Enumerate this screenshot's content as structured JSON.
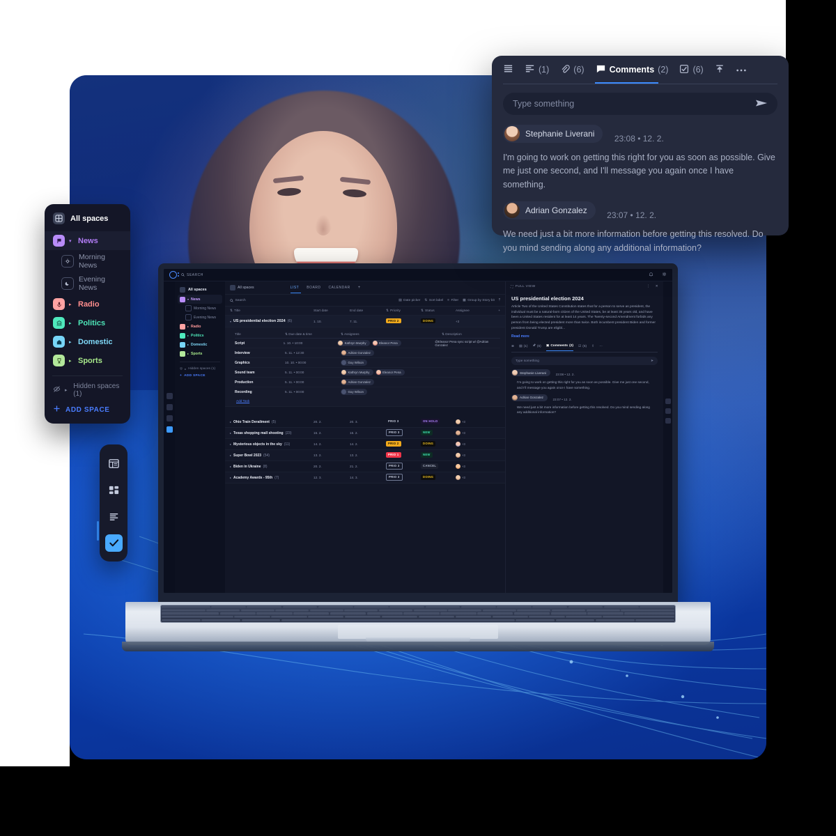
{
  "spaces_panel": {
    "header": "All spaces",
    "items": [
      {
        "label": "News",
        "icon": "flag-icon",
        "color": "#b17cf5",
        "bg": "#b88cf8",
        "expanded": true,
        "children": [
          {
            "label": "Morning News",
            "icon": "sun-icon"
          },
          {
            "label": "Evening News",
            "icon": "moon-icon"
          }
        ]
      },
      {
        "label": "Radio",
        "icon": "microphone-icon",
        "color": "#ff8d8d",
        "bg": "#ffa3a3"
      },
      {
        "label": "Politics",
        "icon": "bank-icon",
        "color": "#4ee6b8",
        "bg": "#4fe9bd"
      },
      {
        "label": "Domestic",
        "icon": "home-icon",
        "color": "#7fd8f7",
        "bg": "#77d5f7"
      },
      {
        "label": "Sports",
        "icon": "trophy-icon",
        "color": "#a7e88a",
        "bg": "#b3e89b"
      }
    ],
    "hidden_spaces": "Hidden spaces (1)",
    "add_space": "ADD SPACE"
  },
  "view_toolbar": {
    "buttons": [
      {
        "icon": "table-view-icon",
        "selected": false
      },
      {
        "icon": "board-view-icon",
        "selected": false
      },
      {
        "icon": "list-view-icon",
        "selected": false
      },
      {
        "icon": "checklist-view-icon",
        "selected": true
      }
    ]
  },
  "comments_card": {
    "tabs": [
      {
        "icon": "menu-icon",
        "label": "",
        "count": ""
      },
      {
        "icon": "description-icon",
        "label": "",
        "count": "(1)"
      },
      {
        "icon": "attachment-icon",
        "label": "",
        "count": "(6)"
      },
      {
        "icon": "comment-icon",
        "label": "Comments",
        "count": "(2)",
        "active": true
      },
      {
        "icon": "checkbox-icon",
        "label": "",
        "count": "(6)"
      },
      {
        "icon": "upload-icon",
        "label": "",
        "count": ""
      },
      {
        "icon": "more-icon",
        "label": "",
        "count": ""
      }
    ],
    "input_placeholder": "Type something",
    "send_icon": "send-icon",
    "messages": [
      {
        "author": "Stephanie Liverani",
        "time": "23:08 • 12. 2.",
        "avatar": "female",
        "body": "I'm going to work on getting this right for you as soon as possible. Give me just one second, and I'll message you again once I have something."
      },
      {
        "author": "Adrian Gonzalez",
        "time": "23:07 • 12. 2.",
        "avatar": "male",
        "body": "We need just a bit more information before getting this resolved. Do you mind sending along any additional information?"
      }
    ]
  },
  "app": {
    "topbar": {
      "search_placeholder": "SEARCH",
      "bell_icon": "bell-icon",
      "gear_icon": "gear-icon",
      "logo": "logo-icon"
    },
    "sidebar": {
      "header": "All spaces",
      "items": [
        {
          "label": "News",
          "bg": "#b88cf8",
          "color": "#c59cff",
          "expanded": true,
          "children": [
            {
              "label": "Morning News"
            },
            {
              "label": "Evening News"
            }
          ]
        },
        {
          "label": "Radio",
          "bg": "#ffa3a3",
          "color": "#ff9a9a"
        },
        {
          "label": "Politics",
          "bg": "#4fe9bd",
          "color": "#4ee6b8"
        },
        {
          "label": "Domestic",
          "bg": "#77d5f7",
          "color": "#7fd8f7"
        },
        {
          "label": "Sports",
          "bg": "#b3e89b",
          "color": "#a7e88a"
        }
      ],
      "hidden_spaces": "Hidden spaces (1)",
      "add_space": "ADD SPACE"
    },
    "center": {
      "all_spaces": "All spaces",
      "tabs": [
        {
          "label": "LIST",
          "active": true
        },
        {
          "label": "BOARD"
        },
        {
          "label": "CALENDAR"
        }
      ],
      "add_tab": "+",
      "filters": {
        "search_placeholder": "Search",
        "date_picker": "Date picker",
        "sort": "Sort label",
        "filter": "Filter",
        "group": "Group by Story bit",
        "collapse_icon": "collapse-icon"
      },
      "columns": [
        "Title",
        "Start date",
        "End date",
        "Priority",
        "Status",
        "Assignee"
      ],
      "group": {
        "title": "US presidential election 2024",
        "count": "(6)",
        "start_date": "1. 10.",
        "end_date": "7. 11.",
        "priority": {
          "label": "PRIO 2",
          "bg": "#f0a91c",
          "color": "#1a1505"
        },
        "status": {
          "label": "DOING",
          "bg": "#0d0d0d",
          "color": "#f0c020"
        },
        "assignee": "+3",
        "sub_columns": [
          "Title",
          "Due date & time",
          "Assignees",
          "Description"
        ],
        "subtasks": [
          {
            "title": "Script",
            "due": "1. 10. • 10:00",
            "assignees": [
              "Kathryn Murphy",
              "Eleanor Pena"
            ],
            "description": "@Eleanor Pena  sync script w/ @Adrian Gonzalez"
          },
          {
            "title": "Interview",
            "due": "5. 11. • 12:30",
            "assignees": [
              "Adrian Gonzalez"
            ],
            "description": ""
          },
          {
            "title": "Graphics",
            "due": "10. 10. • 00:00",
            "assignees": [
              "Guy Wilson"
            ],
            "description": ""
          },
          {
            "title": "Sound team",
            "due": "5. 11. • 00:00",
            "assignees": [
              "Kathryn Murphy",
              "Eleanor Pena"
            ],
            "description": ""
          },
          {
            "title": "Production",
            "due": "5. 11. • 00:00",
            "assignees": [
              "Adrian Gonzalez"
            ],
            "description": ""
          },
          {
            "title": "Recording",
            "due": "5. 11. • 00:00",
            "assignees": [
              "Guy Wilson"
            ],
            "description": ""
          }
        ],
        "add_task": "Add Task"
      },
      "rows": [
        {
          "title": "Ohio Train Derailment",
          "count": "(5)",
          "start": "20. 2.",
          "end": "20. 3.",
          "priority": {
            "label": "PRIO 3",
            "bg": "transparent",
            "color": "#c9cfdf",
            "border": "#6d7governor"
          },
          "status": {
            "label": "ON HOLD",
            "bg": "#1a1330",
            "color": "#b084ff"
          },
          "assignee": "+3"
        },
        {
          "title": "Texas shopping mall shooting",
          "count": "(23)",
          "start": "16. 2.",
          "end": "16. 2.",
          "priority": {
            "label": "PRIO 3",
            "bg": "transparent",
            "color": "#c9cfdf"
          },
          "status": {
            "label": "NEW",
            "bg": "#0d2b24",
            "color": "#3ee6b0"
          },
          "assignee": "+3"
        },
        {
          "title": "Mysterious objects in the sky",
          "count": "(11)",
          "start": "14. 2.",
          "end": "14. 2.",
          "priority": {
            "label": "PRIO 2",
            "bg": "#f0a91c",
            "color": "#1a1505"
          },
          "status": {
            "label": "DOING",
            "bg": "#0d0d0d",
            "color": "#f0c020"
          },
          "assignee": "+3"
        },
        {
          "title": "Super Bowl 2023",
          "count": "(54)",
          "start": "13. 2.",
          "end": "13. 2.",
          "priority": {
            "label": "PRIO 1",
            "bg": "#f0354a",
            "color": "#fff"
          },
          "status": {
            "label": "NEW",
            "bg": "#0d2b24",
            "color": "#3ee6b0"
          },
          "assignee": "+3"
        },
        {
          "title": "Biden in Ukraine",
          "count": "(8)",
          "start": "20. 2.",
          "end": "21. 2.",
          "priority": {
            "label": "PRIO 3",
            "bg": "transparent",
            "color": "#c9cfdf"
          },
          "status": {
            "label": "CANCEL",
            "bg": "#1b1f2e",
            "color": "#aeb5c8"
          },
          "assignee": "+3"
        },
        {
          "title": "Academy Awards - 95th",
          "count": "(7)",
          "start": "12. 3.",
          "end": "14. 3.",
          "priority": {
            "label": "PRIO 3",
            "bg": "transparent",
            "color": "#c9cfdf"
          },
          "status": {
            "label": "DOING",
            "bg": "#0d0d0d",
            "color": "#f0c020"
          },
          "assignee": "+3"
        }
      ]
    },
    "detail": {
      "full_view": "FULL VIEW",
      "more_icon": "more-vertical-icon",
      "close_icon": "close-icon",
      "title": "US presidential election 2024",
      "text": "Article Two of the United States Constitution states that for a person to serve as president, the individual must be a natural-born citizen of the United States, be at least 35 years old, and have been a United States resident for at least 14 years. The Twenty-second Amendment forbids any person from being elected president more than twice. Both incumbent president Biden and former president Donald Trump are eligibl...",
      "read_more": "Read more",
      "tabs": [
        {
          "icon": "menu-icon",
          "count": ""
        },
        {
          "icon": "description-icon",
          "count": "(1)"
        },
        {
          "icon": "attachment-icon",
          "count": "(6)"
        },
        {
          "icon": "comment-icon",
          "label": "Comments",
          "count": "(2)",
          "active": true
        },
        {
          "icon": "checkbox-icon",
          "count": "(6)"
        },
        {
          "icon": "upload-icon",
          "count": ""
        },
        {
          "icon": "more-icon",
          "count": ""
        }
      ],
      "input_placeholder": "Type something",
      "messages": [
        {
          "author": "Stephanie Liverani",
          "time": "23:08 • 12. 2.",
          "avatar": "female",
          "body": "I'm going to work on getting this right for you as soon as possible. Give me just one second, and I'll message you again once I have something."
        },
        {
          "author": "Adrian Gonzalez",
          "time": "23:07 • 12. 2.",
          "avatar": "male",
          "body": "We need just a bit more information before getting this resolved. Do you mind sending along any additional information?"
        }
      ]
    }
  }
}
